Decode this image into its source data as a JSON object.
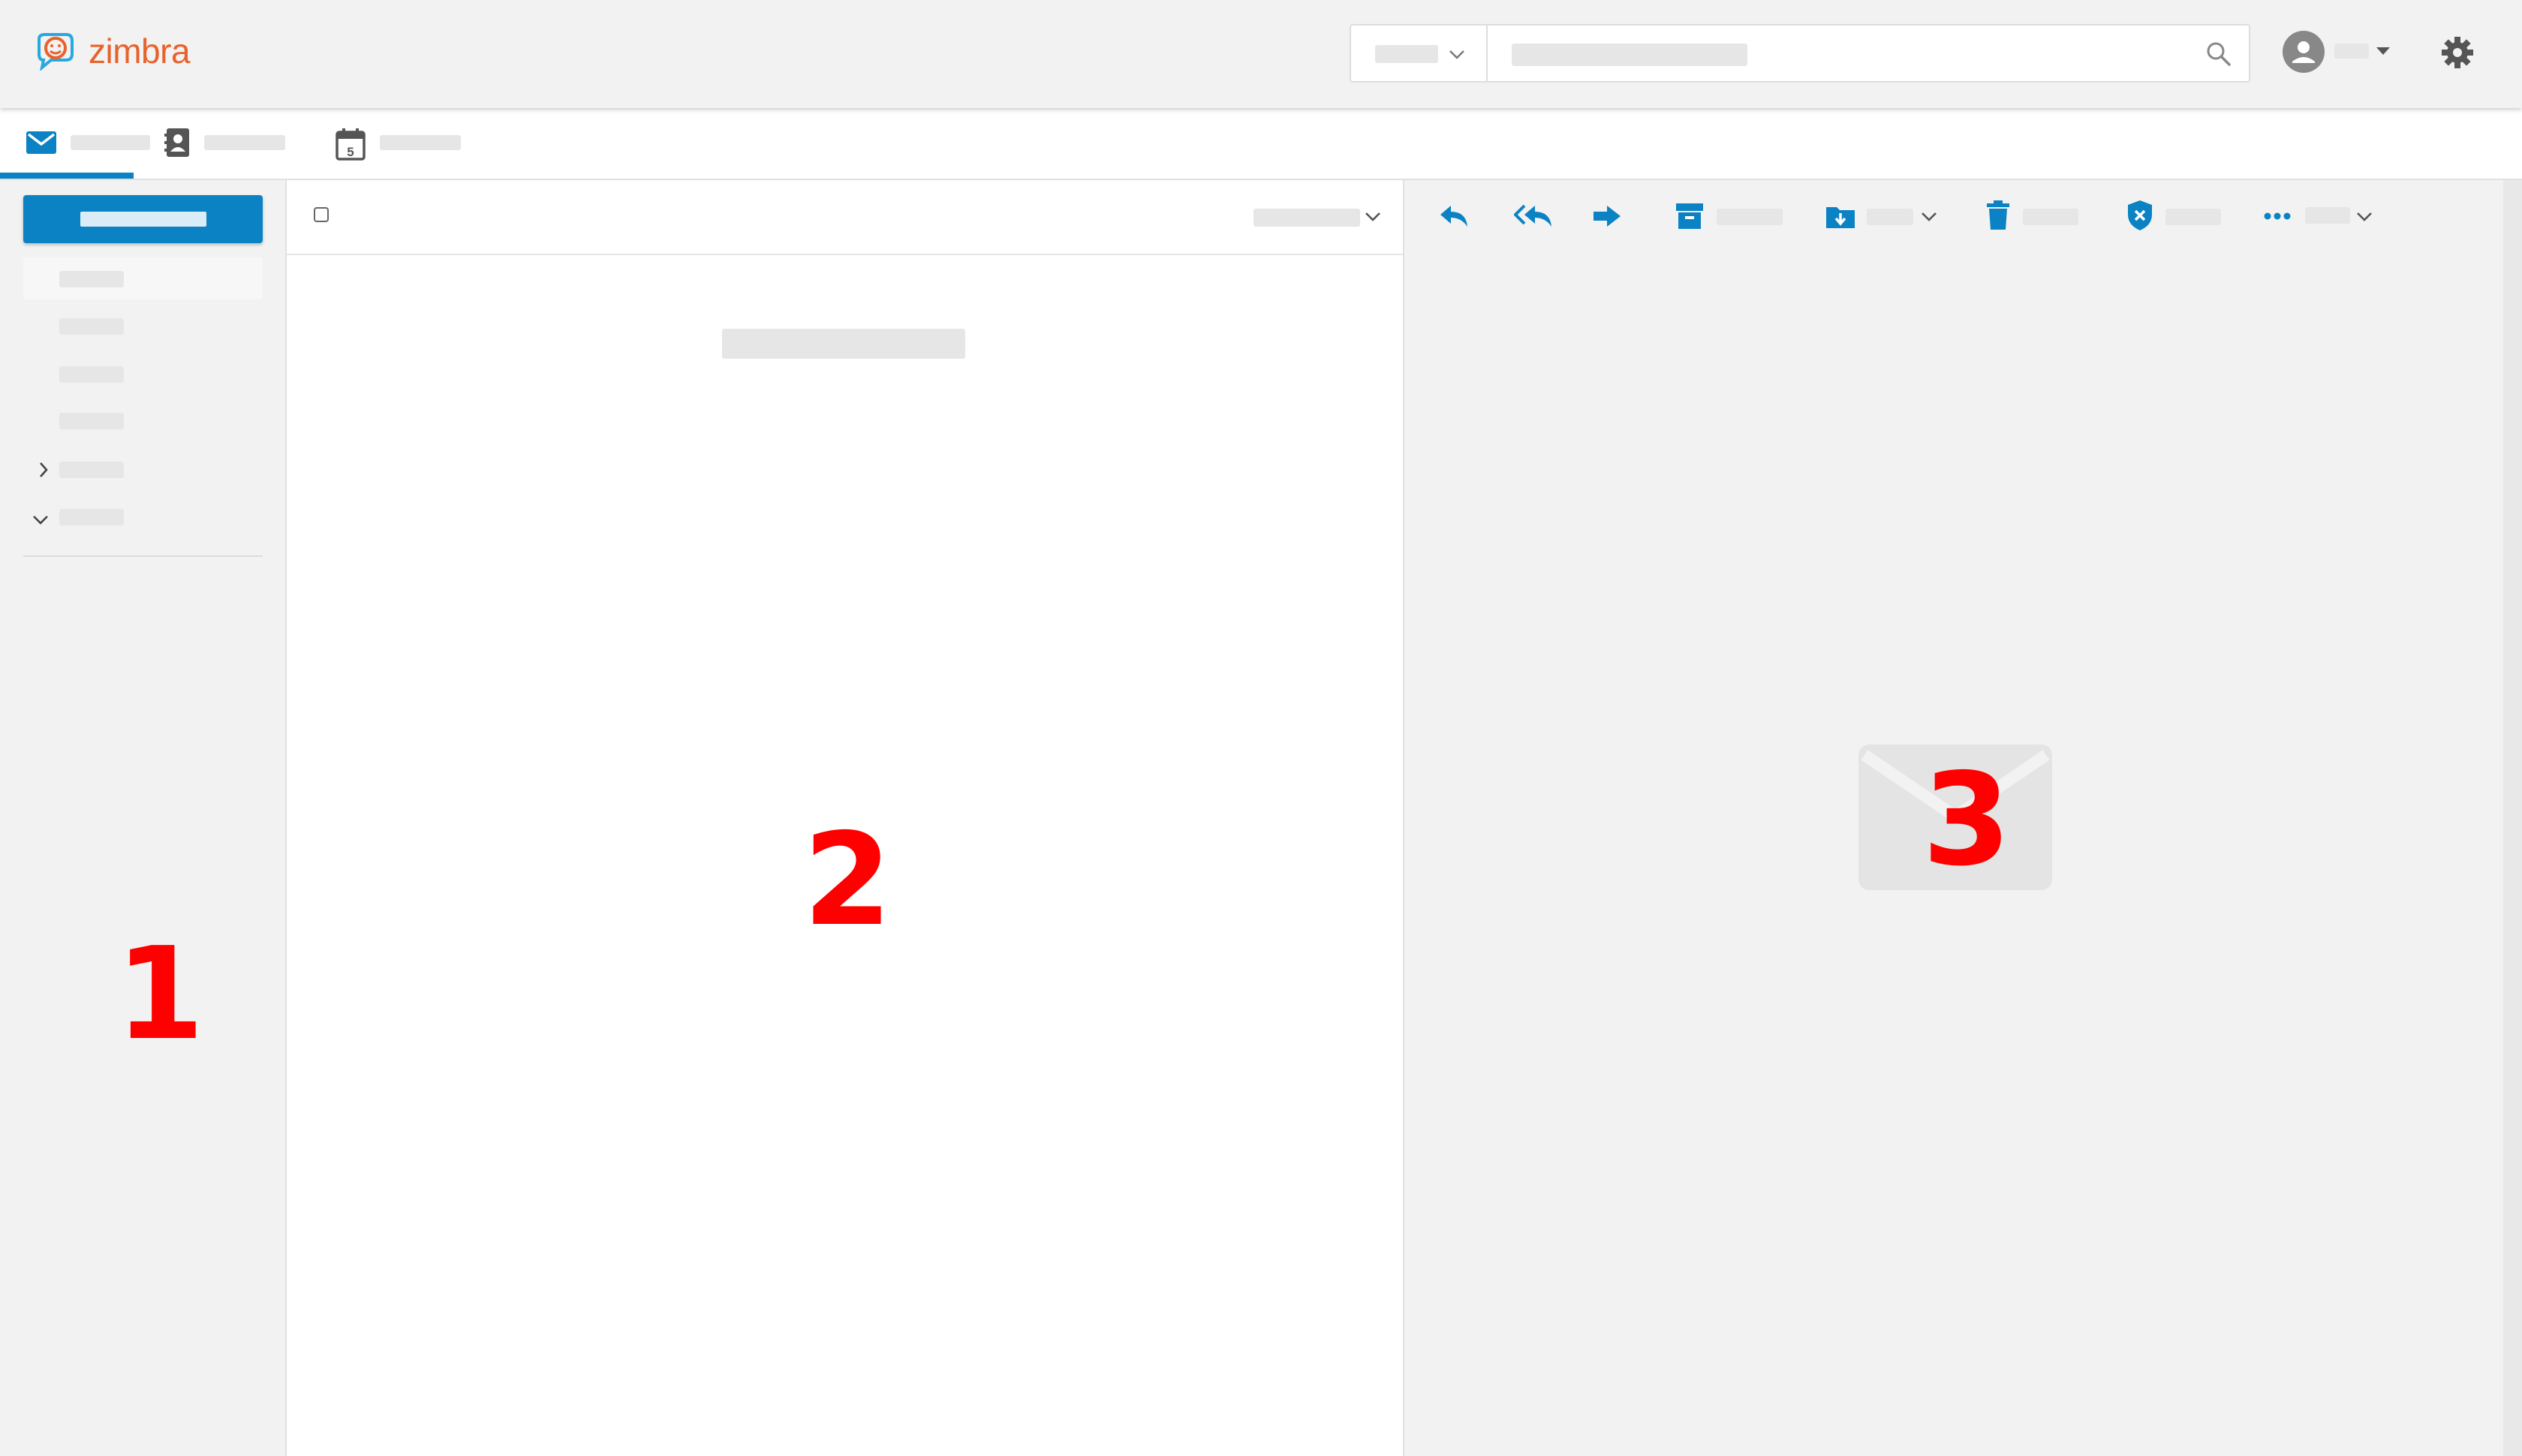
{
  "app": {
    "logo_text": "zimbra",
    "brand_color": "#e8622c",
    "accent_color": "#0b82c4"
  },
  "header": {
    "search_placeholder": "",
    "icons": [
      "search-icon",
      "user-avatar-icon",
      "caret-down-icon",
      "gear-icon"
    ]
  },
  "tabs": [
    {
      "name": "mail",
      "icon": "mail-icon",
      "active": true
    },
    {
      "name": "contacts",
      "icon": "contacts-icon",
      "active": false
    },
    {
      "name": "calendar",
      "icon": "calendar-icon",
      "calendar_day": "5",
      "active": false
    }
  ],
  "toolbar": {
    "icons": [
      "reply-icon",
      "reply-all-icon",
      "forward-icon",
      "archive-icon",
      "move-folder-icon",
      "delete-icon",
      "spam-shield-icon",
      "more-icon"
    ]
  },
  "panels": {
    "sidebar_number": "1",
    "list_number": "2",
    "reading_number": "3"
  }
}
